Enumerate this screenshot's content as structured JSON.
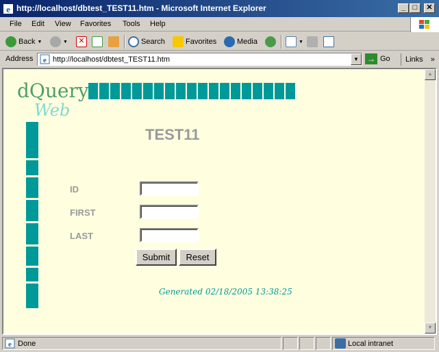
{
  "window": {
    "title": "http://localhost/dbtest_TEST11.htm - Microsoft Internet Explorer",
    "min_glyph": "_",
    "max_glyph": "□",
    "close_glyph": "✕"
  },
  "menu": {
    "file": "File",
    "edit": "Edit",
    "view": "View",
    "favorites": "Favorites",
    "tools": "Tools",
    "help": "Help"
  },
  "toolbar": {
    "back": "Back",
    "search": "Search",
    "favorites": "Favorites",
    "media": "Media"
  },
  "address": {
    "label": "Address",
    "url": "http://localhost/dbtest_TEST11.htm",
    "go": "Go",
    "links": "Links",
    "links_more": "»"
  },
  "page": {
    "logo_primary": "dQuery",
    "logo_secondary": "Web",
    "title": "TEST11",
    "fields": [
      {
        "label": "ID",
        "value": ""
      },
      {
        "label": "FIRST",
        "value": ""
      },
      {
        "label": "LAST",
        "value": ""
      }
    ],
    "submit": "Submit",
    "reset": "Reset",
    "generated": "Generated 02/18/2005 13:38:25",
    "accent_color": "#009999"
  },
  "status": {
    "text": "Done",
    "zone": "Local intranet"
  }
}
